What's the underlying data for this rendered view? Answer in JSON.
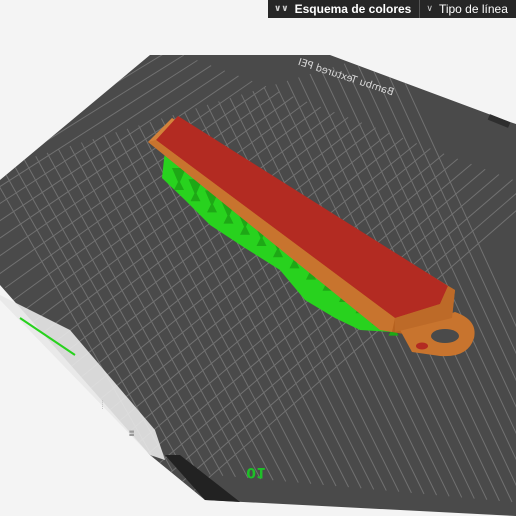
{
  "toolbar": {
    "color_scheme_label": "Esquema de colores",
    "line_type_label": "Tipo de línea"
  },
  "plate": {
    "brand_text": "Bambu Textured PEI",
    "plate_number": "01"
  },
  "colors": {
    "background": "#f4f4f4",
    "plate_surface": "#4a4a4a",
    "grid": "#7e7e7e",
    "model_wall": "#c8742e",
    "model_top": "#b32b22",
    "support": "#28d21e"
  },
  "icons": {
    "color_scheme_toggle": "double-chevron-down-icon",
    "line_type_toggle": "chevron-down-icon"
  }
}
